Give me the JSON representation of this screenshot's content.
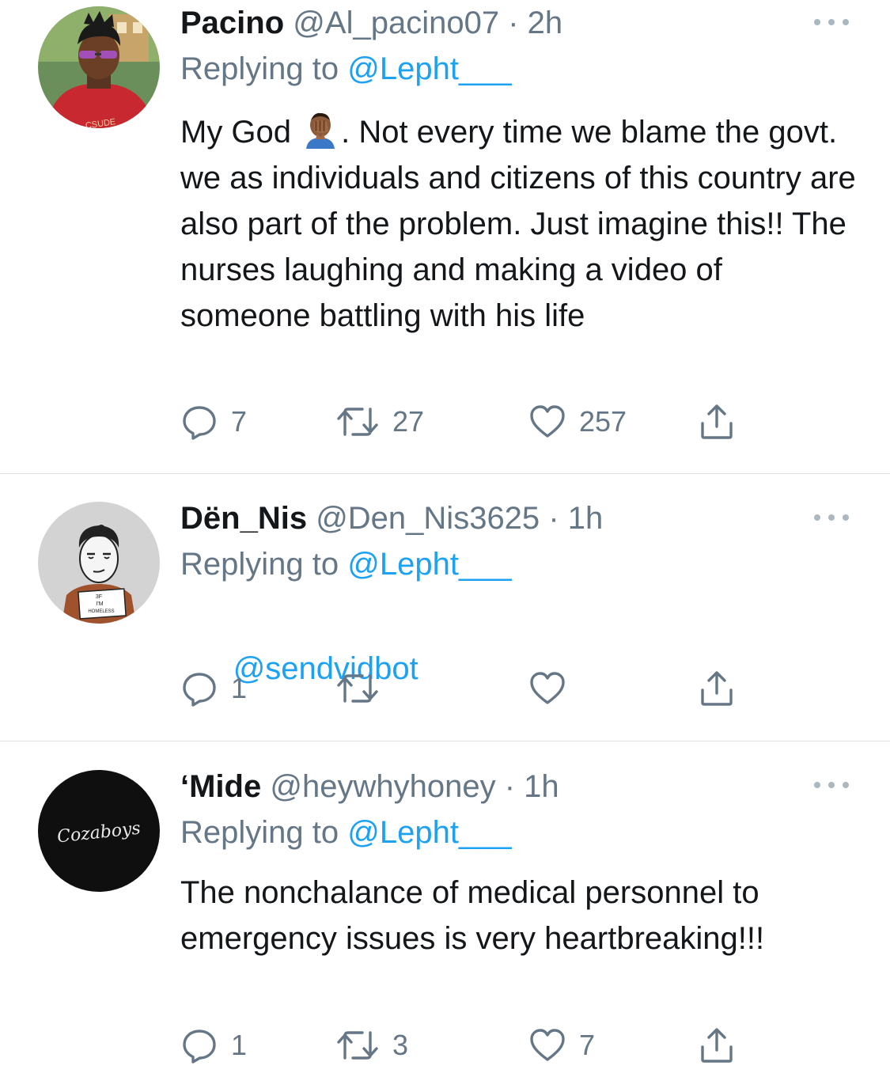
{
  "tweets": [
    {
      "display_name": "Pacino",
      "handle": "@Al_pacino07",
      "separator": "·",
      "time": "2h",
      "replying_prefix": "Replying to ",
      "replying_to": "@Lepht___",
      "text_before_emoji": "My God ",
      "emoji_name": "facepalm-emoji",
      "text_after_emoji": ". Not every time we blame the govt. we as individuals and citizens of this country are also part of the problem. Just imagine this!! The nurses laughing and making a video of someone battling with his life",
      "replies": "7",
      "retweets": "27",
      "likes": "257",
      "avatar_label": "CSUDE"
    },
    {
      "display_name": "Dën_Nis",
      "handle": "@Den_Nis3625",
      "separator": "·",
      "time": "1h",
      "replying_prefix": "Replying to ",
      "replying_to": "@Lepht___",
      "text": "@sendvidbot",
      "replies": "1",
      "retweets": "",
      "likes": "",
      "avatar_sign": [
        "3F",
        "I'M",
        "HOMELESS"
      ]
    },
    {
      "display_name": "‘Mide",
      "handle": "@heywhyhoney",
      "separator": "·",
      "time": "1h",
      "replying_prefix": "Replying to ",
      "replying_to": "@Lepht___",
      "text": "The nonchalance of medical personnel to emergency issues is very heartbreaking!!!",
      "replies": "1",
      "retweets": "3",
      "likes": "7",
      "avatar_logo": "Cozaboys"
    }
  ],
  "colors": {
    "link": "#1da1f2",
    "secondary_text": "#657786",
    "primary_text": "#14171a",
    "icon": "#657786",
    "divider": "#dfe3e6"
  },
  "icons": {
    "reply": "reply-icon",
    "retweet": "retweet-icon",
    "like": "like-icon",
    "share": "share-icon",
    "more": "more-icon"
  }
}
